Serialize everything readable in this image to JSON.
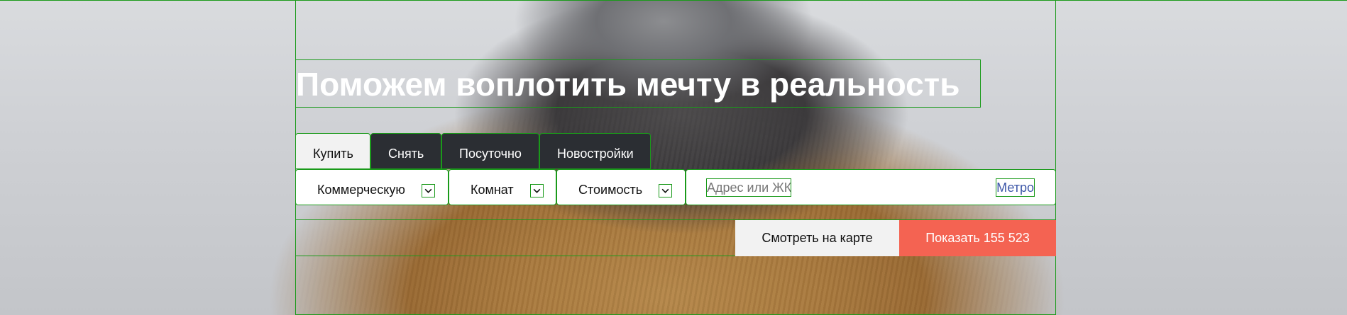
{
  "hero": {
    "title": "Поможем воплотить мечту в реальность"
  },
  "tabs": [
    {
      "label": "Купить",
      "active": true
    },
    {
      "label": "Снять",
      "active": false
    },
    {
      "label": "Посуточно",
      "active": false
    },
    {
      "label": "Новостройки",
      "active": false
    }
  ],
  "filters": {
    "property_type": "Коммерческую",
    "rooms": "Комнат",
    "price": "Стоимость",
    "search_placeholder": "Адрес или ЖК",
    "metro_label": "Метро"
  },
  "actions": {
    "map_label": "Смотреть на карте",
    "show_label": "Показать 155 523"
  },
  "colors": {
    "accent": "#f46352",
    "tab_inactive": "#2b2e33",
    "tab_active": "#f2f2f2",
    "link": "#3d57a8"
  },
  "icons": {
    "dropdown": "chevron-down-icon"
  }
}
